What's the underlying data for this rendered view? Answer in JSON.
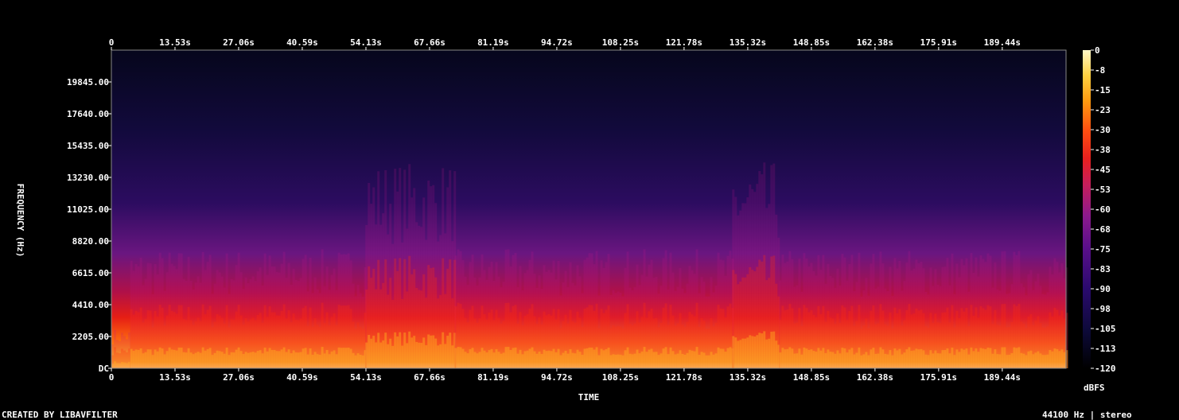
{
  "chart_data": {
    "type": "heatmap",
    "xlabel": "TIME",
    "ylabel": "FREQUENCY (Hz)",
    "x_ticks": [
      "0",
      "13.53s",
      "27.06s",
      "40.59s",
      "54.13s",
      "67.66s",
      "81.19s",
      "94.72s",
      "108.25s",
      "121.78s",
      "135.32s",
      "148.85s",
      "162.38s",
      "175.91s",
      "189.44s"
    ],
    "x_tick_values": [
      0,
      13.53,
      27.06,
      40.59,
      54.13,
      67.66,
      81.19,
      94.72,
      108.25,
      121.78,
      135.32,
      148.85,
      162.38,
      175.91,
      189.44
    ],
    "xlim": [
      0,
      203.0
    ],
    "y_ticks": [
      "DC",
      "2205.00",
      "4410.00",
      "6615.00",
      "8820.00",
      "11025.00",
      "13230.00",
      "15435.00",
      "17640.00",
      "19845.00"
    ],
    "y_tick_values": [
      0,
      2205,
      4410,
      6615,
      8820,
      11025,
      13230,
      15435,
      17640,
      19845
    ],
    "ylim": [
      0,
      22050
    ],
    "colorbar": {
      "label": "dBFS",
      "ticks": [
        "0",
        "-8",
        "-15",
        "-23",
        "-30",
        "-38",
        "-45",
        "-53",
        "-60",
        "-68",
        "-75",
        "-83",
        "-90",
        "-98",
        "-105",
        "-113",
        "-120"
      ],
      "range": [
        -120,
        0
      ],
      "colors": [
        "#000000",
        "#0d0a3a",
        "#2a0a6e",
        "#5a0f8a",
        "#8c1a8c",
        "#c81e5a",
        "#e8201e",
        "#ff5010",
        "#ff9a10",
        "#ffd040",
        "#fff8c8"
      ]
    },
    "energy_profile_note_segments": [
      {
        "t_start": 0,
        "t_end": 4,
        "level": "low"
      },
      {
        "t_start": 4,
        "t_end": 54,
        "level": "medium"
      },
      {
        "t_start": 54,
        "t_end": 73,
        "level": "high"
      },
      {
        "t_start": 73,
        "t_end": 132,
        "level": "medium"
      },
      {
        "t_start": 132,
        "t_end": 142,
        "level": "high"
      },
      {
        "t_start": 142,
        "t_end": 203,
        "level": "medium"
      }
    ]
  },
  "footer": {
    "left": "CREATED BY LIBAVFILTER",
    "right": "44100 Hz | stereo"
  }
}
